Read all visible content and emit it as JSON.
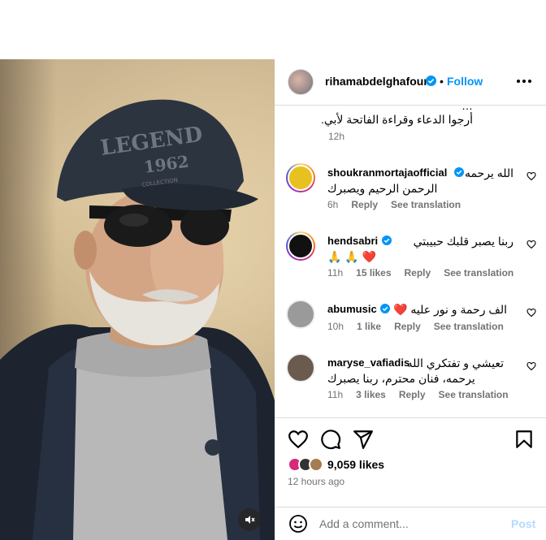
{
  "post": {
    "username": "rihamabdelghafour",
    "follow_label": "Follow",
    "dot": "•",
    "more_label": "•••",
    "caption_hidden_line": "…",
    "caption_line": "أرجوا الدعاء وقراءة الفاتحة لأبي.",
    "caption_time": "12h",
    "photo_cap_text": "LEGEND",
    "photo_cap_number": "1962",
    "photo_cap_small": "COLLECTION"
  },
  "comments": [
    {
      "username": "shoukranmortajaofficial",
      "verified": true,
      "line1": "الله يرحمه",
      "line2": "الرحمن الرحيم ويصبرك",
      "time": "6h",
      "likes": "",
      "reply": "Reply",
      "translate": "See translation",
      "avatar_color": "#e7c11f"
    },
    {
      "username": "hendsabri",
      "verified": true,
      "line1": "ربنا يصبر قلبك حبيبتي",
      "line2": "❤️ 🙏 🙏",
      "time": "11h",
      "likes": "15 likes",
      "reply": "Reply",
      "translate": "See translation",
      "avatar_color": "#111111"
    },
    {
      "username": "abumusic",
      "verified": true,
      "line1": "الف رحمة و نور عليه ❤️",
      "line2": "",
      "time": "10h",
      "likes": "1 like",
      "reply": "Reply",
      "translate": "See translation",
      "avatar_color": "#9a9a9a"
    },
    {
      "username": "maryse_vafiadis",
      "verified": false,
      "line1": "تعيشي و تفتكري الله",
      "line2": "يرحمه، فنان محترم، ربنا يصبرك",
      "time": "11h",
      "likes": "3 likes",
      "reply": "Reply",
      "translate": "See translation",
      "avatar_color": "#6b5a4e"
    }
  ],
  "footer": {
    "likes_count": "9,059 likes",
    "post_time": "12 hours ago",
    "comment_placeholder": "Add a comment...",
    "post_label": "Post"
  },
  "icons": [
    "verified-badge-icon",
    "more-options-icon",
    "heart-icon",
    "comment-icon",
    "share-icon",
    "bookmark-icon",
    "emoji-icon",
    "mute-icon"
  ],
  "colors": {
    "accent": "#0095f6",
    "muted_text": "#737373",
    "divider": "#dbdbdb",
    "post_disabled": "#b3dbff"
  }
}
